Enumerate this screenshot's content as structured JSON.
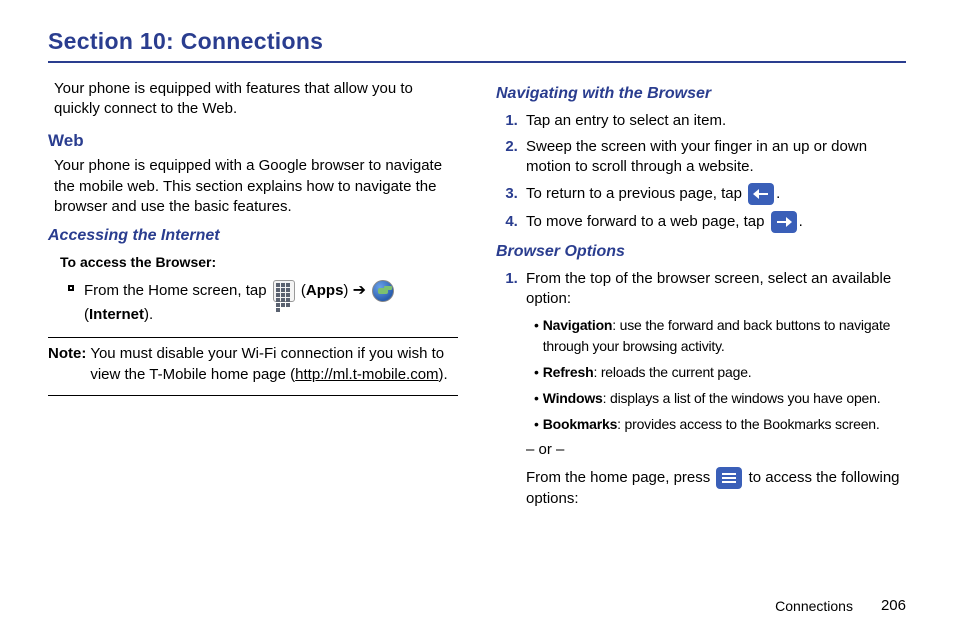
{
  "section_title": "Section 10: Connections",
  "left": {
    "intro": "Your phone is equipped with features that allow you to quickly connect to the Web.",
    "web_heading": "Web",
    "web_body": "Your phone is equipped with a Google browser to navigate the mobile web. This section explains how to navigate the browser and use the basic features.",
    "accessing_heading": "Accessing the Internet",
    "to_access": "To access the Browser:",
    "from_home_pre": "From the Home screen, tap ",
    "apps_label": "Apps",
    "internet_label": "Internet",
    "note_label": "Note:",
    "note_body_1": "You must disable your Wi-Fi connection if you wish to view the T-Mobile home page (",
    "note_link": "http://ml.t-mobile.com",
    "note_body_2": ")."
  },
  "right": {
    "nav_heading": "Navigating with the Browser",
    "nav_items": [
      "Tap an entry to select an item.",
      "Sweep the screen with your finger in an up or down motion to scroll through a website.",
      "To return to a previous page, tap ",
      "To move forward to a web page, tap "
    ],
    "period": ".",
    "options_heading": "Browser Options",
    "opt_intro": "From the top of the browser screen, select an available option:",
    "opt_bullets": [
      {
        "term": "Navigation",
        "desc": ": use the forward and back buttons to navigate through your browsing activity."
      },
      {
        "term": "Refresh",
        "desc": ": reloads the current page."
      },
      {
        "term": "Windows",
        "desc": ": displays a list of the windows you have open."
      },
      {
        "term": "Bookmarks",
        "desc": ": provides access to the Bookmarks screen."
      }
    ],
    "or": "– or –",
    "home_press_pre": "From the home page, press ",
    "home_press_post": " to access the following options:"
  },
  "footer": {
    "chapter": "Connections",
    "page": "206"
  }
}
